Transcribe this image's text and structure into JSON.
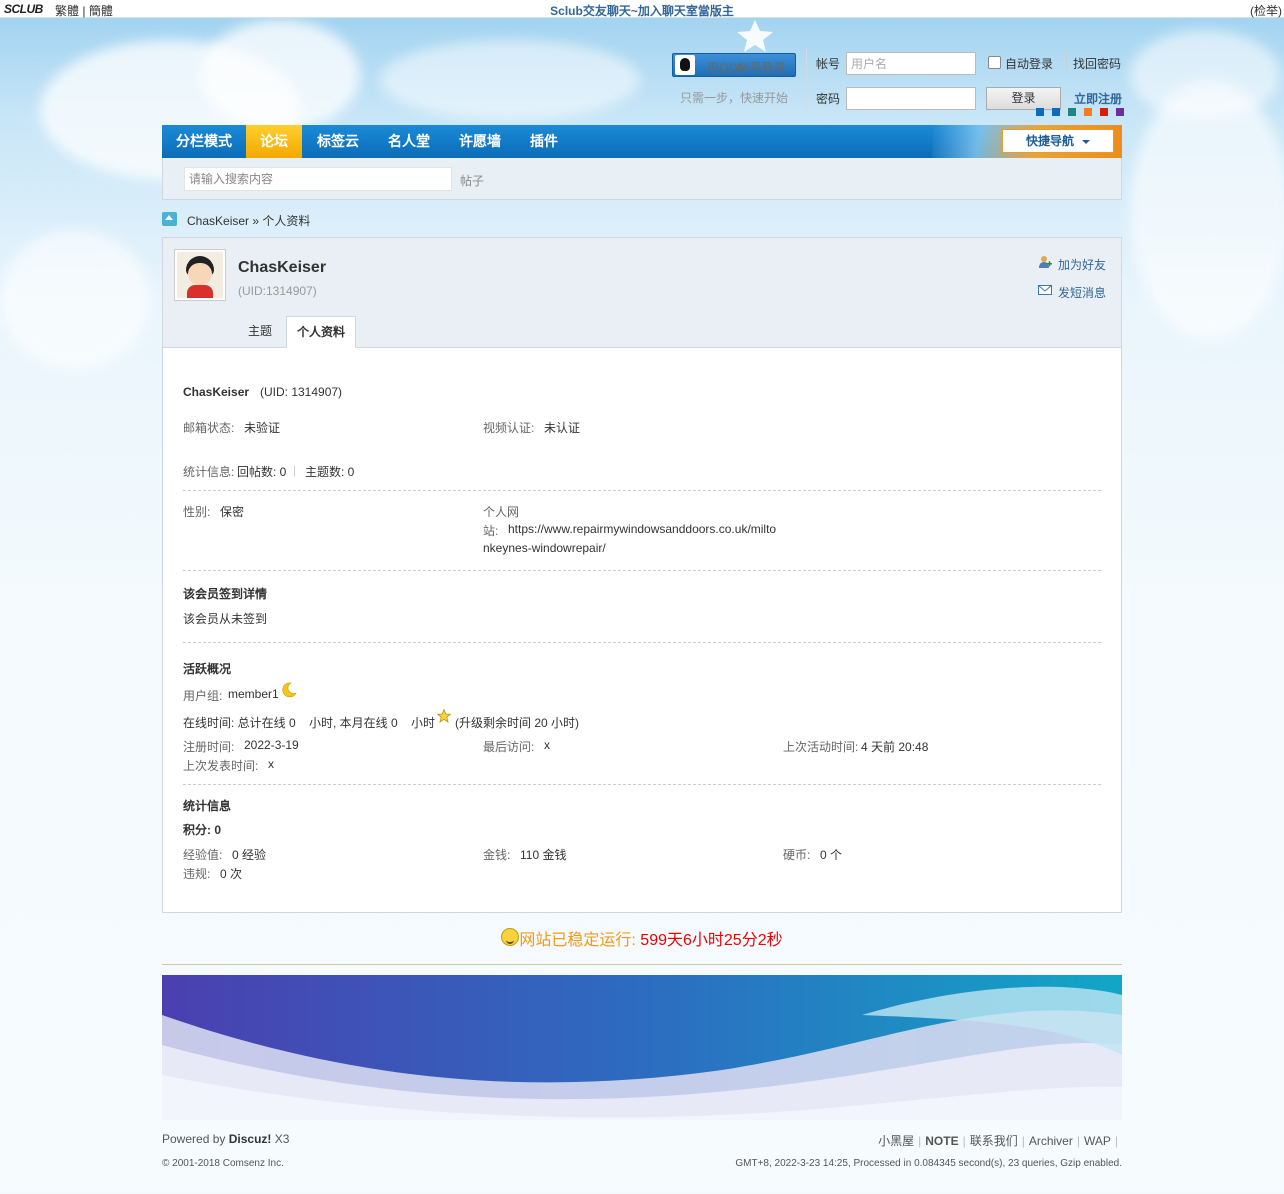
{
  "topbar": {
    "logo": "SCLUB",
    "lang_trad": "繁體",
    "lang_sep": "|",
    "lang_simp": "簡體",
    "title": "Sclub交友聊天~加入聊天室當版主",
    "right": "(检举)"
  },
  "login": {
    "qq_button": "用QQ帐号登录",
    "one_step": "只需一步，快速开始",
    "account_label": "帐号",
    "account_placeholder": "用户名",
    "password_label": "密码",
    "auto_login": "自动登录",
    "find_password": "找回密码",
    "login_button": "登录",
    "register": "立即注册",
    "style_colors": [
      "#0a6cbf",
      "#0a6cbf",
      "#20857a",
      "#f47c1a",
      "#d81e06",
      "#6b2f9a"
    ]
  },
  "nav": {
    "items": [
      "分栏模式",
      "论坛",
      "标签云",
      "名人堂",
      "许愿墙",
      "插件"
    ],
    "active": "论坛",
    "quick_nav": "快捷导航"
  },
  "search": {
    "placeholder": "请输入搜索内容",
    "type": "帖子"
  },
  "breadcrumb": {
    "text": "ChasKeiser » 个人资料"
  },
  "profile": {
    "username": "ChasKeiser",
    "uid_display": "(UID:1314907)",
    "add_friend": "加为好友",
    "send_message": "发短消息",
    "tabs": [
      "主题",
      "个人资料"
    ],
    "active_tab": "个人资料",
    "name_line": "ChasKeiser",
    "uid_line": "(UID: 1314907)",
    "email_status_label": "邮箱状态:",
    "email_status": "未验证",
    "video_auth_label": "视频认证:",
    "video_auth": "未认证",
    "stats_label": "统计信息:",
    "replies": "回帖数: 0",
    "topics": "主题数: 0",
    "gender_label": "性别:",
    "gender": "保密",
    "website_label_1": "个人网",
    "website_label_2": "站:",
    "website_line_1": "https://www.repairmywindowsanddoors.co.uk/milto",
    "website_line_2": "nkeynes-windowrepair/",
    "signin_title": "该会员签到详情",
    "signin_text": "该会员从未签到",
    "activity_title": "活跃概况",
    "usergroup_label": "用户组:",
    "usergroup": "member1",
    "online_time": "在线时间: 总计在线 0    小时, 本月在线 0    小时",
    "upgrade_note": "(升级剩余时间 20 小时)",
    "reg_time_label": "注册时间:",
    "reg_time": "2022-3-19",
    "last_visit_label": "最后访问:",
    "last_visit": "x",
    "last_active_label": "上次活动时间:",
    "last_active": "4 天前 20:48",
    "last_post_label": "上次发表时间:",
    "last_post": "x",
    "stats_title": "统计信息",
    "points": "积分: 0",
    "exp_label": "经验值:",
    "exp": "0 经验",
    "money_label": "金钱:",
    "money": "110 金钱",
    "coin_label": "硬币:",
    "coin": "0 个",
    "violation_label": "违规:",
    "violation": "0 次"
  },
  "footer": {
    "runtime_prefix": "网站已稳定运行: ",
    "runtime_value": "599天6小时25分2秒",
    "powered_by": "Powered by",
    "discuz": "Discuz!",
    "version": "X3",
    "copyright": "© 2001-2018 Comsenz Inc.",
    "links": [
      "小黑屋",
      "NOTE",
      "联系我们",
      "Archiver",
      "WAP"
    ],
    "server_info": "GMT+8, 2022-3-23 14:25, Processed in 0.084345 second(s), 23 queries, Gzip enabled."
  }
}
